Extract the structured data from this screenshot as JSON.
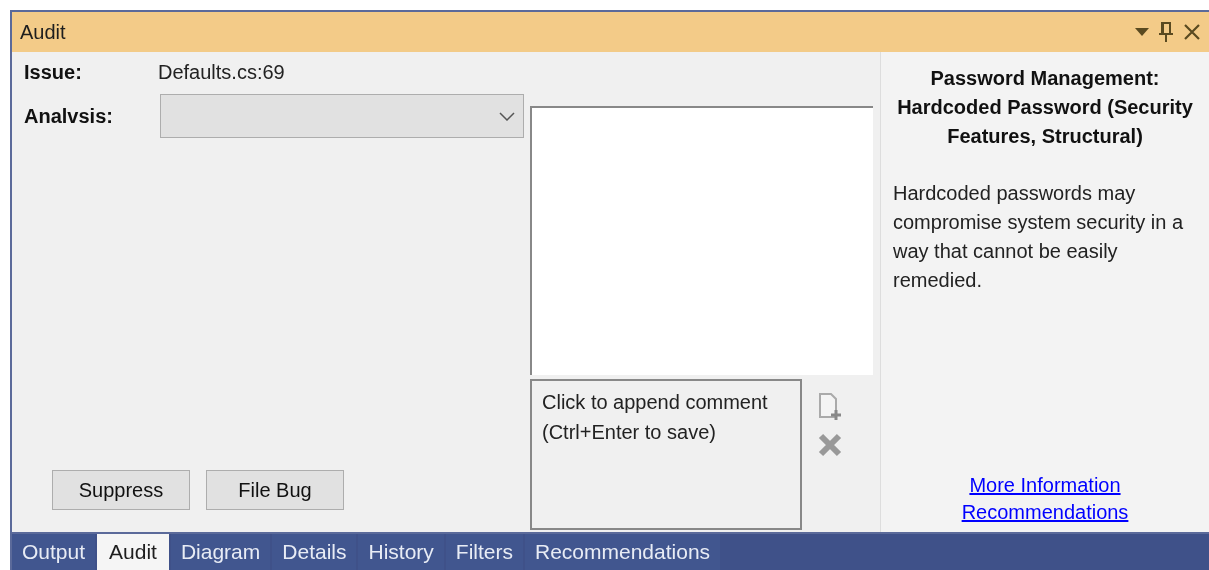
{
  "window": {
    "title": "Audit"
  },
  "issue": {
    "label": "Issue:",
    "value": "Defaults.cs:69"
  },
  "analysis": {
    "label": "Analvsis:"
  },
  "comment": {
    "placeholder": "Click to append comment (Ctrl+Enter to save)"
  },
  "buttons": [
    "Suppress",
    "File Bug"
  ],
  "description": {
    "title": "Password Management: Hardcoded Password (Security Features, Structural)",
    "text": "Hardcoded passwords may compromise system security in a way that cannot be easily remedied.",
    "links": [
      "More Information",
      "Recommendations"
    ]
  },
  "tabs": [
    {
      "label": "Output",
      "selected": false
    },
    {
      "label": "Audit",
      "selected": true
    },
    {
      "label": "Diagram",
      "selected": false
    },
    {
      "label": "Details",
      "selected": false
    },
    {
      "label": "History",
      "selected": false
    },
    {
      "label": "Filters",
      "selected": false
    },
    {
      "label": "Recommendations",
      "selected": false
    }
  ]
}
